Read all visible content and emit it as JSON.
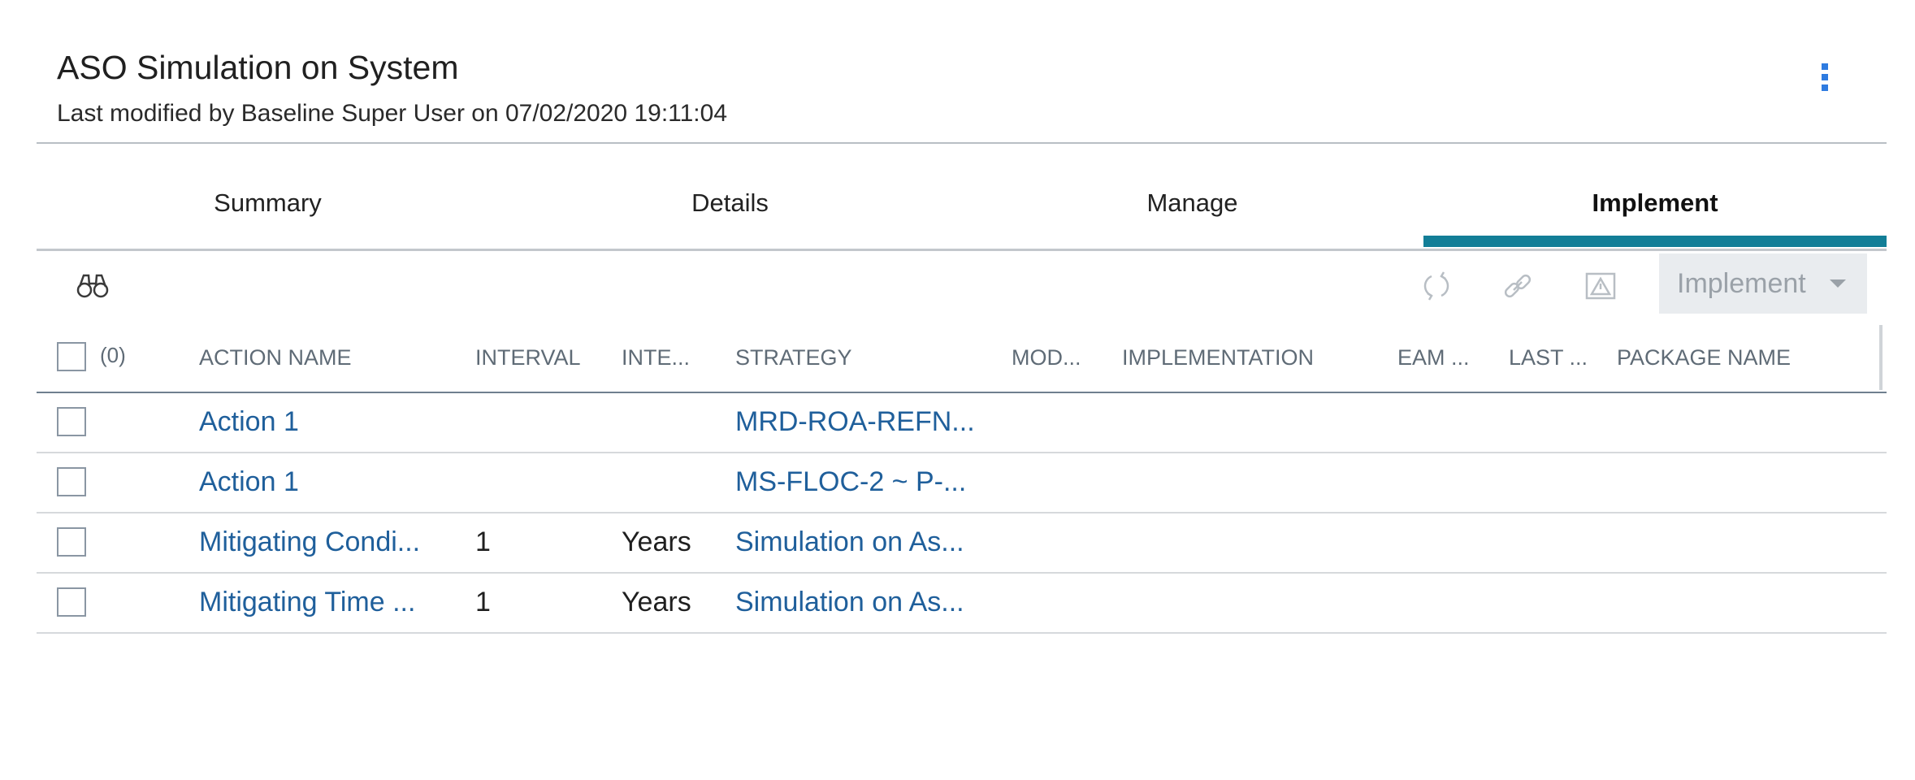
{
  "header": {
    "title": "ASO Simulation on System",
    "subtitle": "Last modified by Baseline Super User on 07/02/2020 19:11:04"
  },
  "tabs": [
    {
      "label": "Summary",
      "active": false
    },
    {
      "label": "Details",
      "active": false
    },
    {
      "label": "Manage",
      "active": false
    },
    {
      "label": "Implement",
      "active": true
    }
  ],
  "colors": {
    "accent": "#127e97",
    "link": "#1f5f9b",
    "kebab": "#2e7be0"
  },
  "toolbar": {
    "search_icon": "binoculars-icon",
    "icons": [
      "refresh-icon",
      "link-icon",
      "warning-image-icon"
    ],
    "implement_label": "Implement"
  },
  "grid": {
    "selected_count": "(0)",
    "columns": [
      "ACTION NAME",
      "INTERVAL",
      "INTE...",
      "STRATEGY",
      "MOD...",
      "IMPLEMENTATION",
      "EAM ...",
      "LAST ...",
      "PACKAGE NAME"
    ],
    "rows": [
      {
        "action_name": "Action 1",
        "interval": "",
        "interval_units": "",
        "strategy": "MRD-ROA-REFN..."
      },
      {
        "action_name": "Action 1",
        "interval": "",
        "interval_units": "",
        "strategy": "MS-FLOC-2 ~ P-..."
      },
      {
        "action_name": "Mitigating Condi...",
        "interval": "1",
        "interval_units": "Years",
        "strategy": "Simulation on As..."
      },
      {
        "action_name": "Mitigating Time ...",
        "interval": "1",
        "interval_units": "Years",
        "strategy": "Simulation on As..."
      }
    ]
  }
}
